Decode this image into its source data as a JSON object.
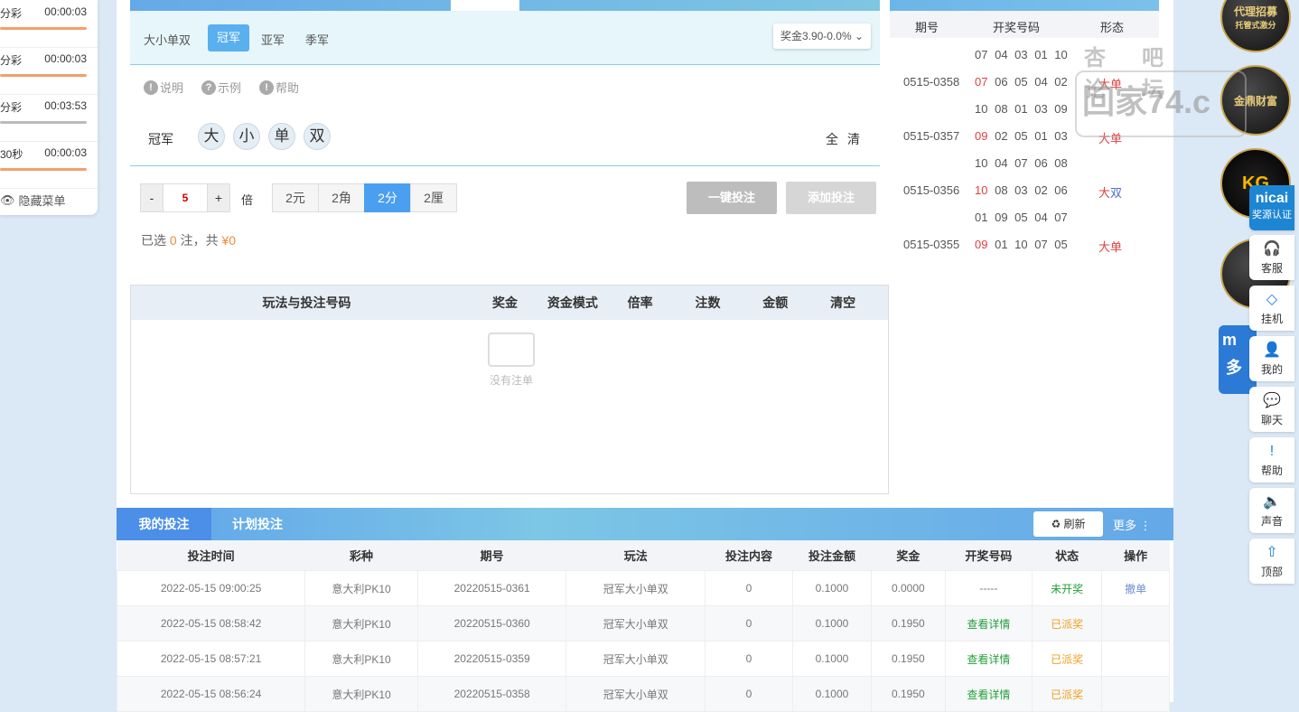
{
  "left_menu": {
    "rows": [
      {
        "name": "分彩",
        "time": "00:00:03"
      },
      {
        "name": "分彩",
        "time": "00:00:03"
      },
      {
        "name": "分彩",
        "time": "00:03:53"
      },
      {
        "name": "30秒",
        "time": "00:00:03"
      }
    ],
    "hide_label": "隐藏菜单"
  },
  "subtabs": {
    "group_label": "大小单双",
    "items": [
      "冠军",
      "亚军",
      "季军"
    ],
    "active": "冠军",
    "prize": "奖金3.90-0.0%"
  },
  "help_links": [
    "说明",
    "示例",
    "帮助"
  ],
  "pick": {
    "label": "冠军",
    "balls": [
      "大",
      "小",
      "单",
      "双"
    ],
    "all": "全",
    "clear": "清"
  },
  "multiplier": {
    "minus": "-",
    "value": "5",
    "plus": "+",
    "unit": "倍"
  },
  "units": [
    "2元",
    "2角",
    "2分",
    "2厘"
  ],
  "active_unit": "2分",
  "buttons": {
    "quick_bet": "一键投注",
    "add_bet": "添加投注"
  },
  "selection": {
    "prefix": "已选",
    "count": "0",
    "middle": "注，共",
    "amount": "¥0"
  },
  "history": {
    "headers": [
      "期号",
      "开奖号码",
      "形态"
    ],
    "rows": [
      {
        "issue": "",
        "first": "07",
        "rest": "04 03 01 10",
        "form_a": "",
        "form_b": ""
      },
      {
        "issue": "0515-0358",
        "first": "07",
        "rest": "06 05 04 02",
        "form_a": "大单",
        "form_b": ""
      },
      {
        "issue": "",
        "first": "10",
        "rest": "08 01 03 09",
        "form_a": "",
        "form_b": ""
      },
      {
        "issue": "0515-0357",
        "first": "09",
        "rest": "02 05 01 03",
        "form_a": "大单",
        "form_b": ""
      },
      {
        "issue": "",
        "first": "10",
        "rest": "04 07 06 08",
        "form_a": "",
        "form_b": ""
      },
      {
        "issue": "0515-0356",
        "first": "10",
        "rest": "08 03 02 06",
        "form_a": "大",
        "form_b": "双"
      },
      {
        "issue": "",
        "first": "01",
        "rest": "09 05 04 07",
        "form_a": "",
        "form_b": ""
      },
      {
        "issue": "0515-0355",
        "first": "09",
        "rest": "01 10 07 05",
        "form_a": "大单",
        "form_b": ""
      }
    ]
  },
  "betlist": {
    "headers": [
      "玩法与投注号码",
      "奖金",
      "资金模式",
      "倍率",
      "注数",
      "金额",
      "清空"
    ],
    "empty": "没有注单"
  },
  "bets": {
    "tabs": [
      "我的投注",
      "计划投注"
    ],
    "refresh": "刷新",
    "more": "更多",
    "headers": [
      "投注时间",
      "彩种",
      "期号",
      "玩法",
      "投注内容",
      "投注金额",
      "奖金",
      "开奖号码",
      "状态",
      "操作"
    ],
    "rows": [
      [
        "2022-05-15 09:00:25",
        "意大利PK10",
        "20220515-0361",
        "冠军大小单双",
        "0",
        "0.1000",
        "0.0000",
        "-----",
        "未开奖",
        "撤单"
      ],
      [
        "2022-05-15 08:58:42",
        "意大利PK10",
        "20220515-0360",
        "冠军大小单双",
        "0",
        "0.1000",
        "0.1950",
        "查看详情",
        "已派奖",
        ""
      ],
      [
        "2022-05-15 08:57:21",
        "意大利PK10",
        "20220515-0359",
        "冠军大小单双",
        "0",
        "0.1000",
        "0.1950",
        "查看详情",
        "已派奖",
        ""
      ],
      [
        "2022-05-15 08:56:24",
        "意大利PK10",
        "20220515-0358",
        "冠军大小单双",
        "0",
        "0.1000",
        "0.1950",
        "查看详情",
        "已派奖",
        ""
      ]
    ]
  },
  "side_ads": {
    "badge1_a": "代理招募",
    "badge1_b": "托管式激分",
    "badge2": "金鼎财富",
    "badge3": "KG",
    "watermark_top": "杏吧 论坛",
    "watermark": "回家74.c",
    "multicai_a": "m",
    "multicai_b": "多"
  },
  "toolbar": [
    {
      "label": "客服",
      "icon": "headset-icon"
    },
    {
      "label": "挂机",
      "icon": "diamond-icon"
    },
    {
      "label": "我的",
      "icon": "user-icon"
    },
    {
      "label": "聊天",
      "icon": "chat-icon"
    },
    {
      "label": "帮助",
      "icon": "help-icon"
    },
    {
      "label": "声音",
      "icon": "sound-icon"
    },
    {
      "label": "顶部",
      "icon": "top-icon"
    }
  ],
  "cert": {
    "brand": "nicai",
    "label": "奖源认证"
  },
  "colors": {
    "accent": "#4a9ff0",
    "red": "#e04040",
    "green": "#23a03a",
    "orange": "#f0a020"
  }
}
